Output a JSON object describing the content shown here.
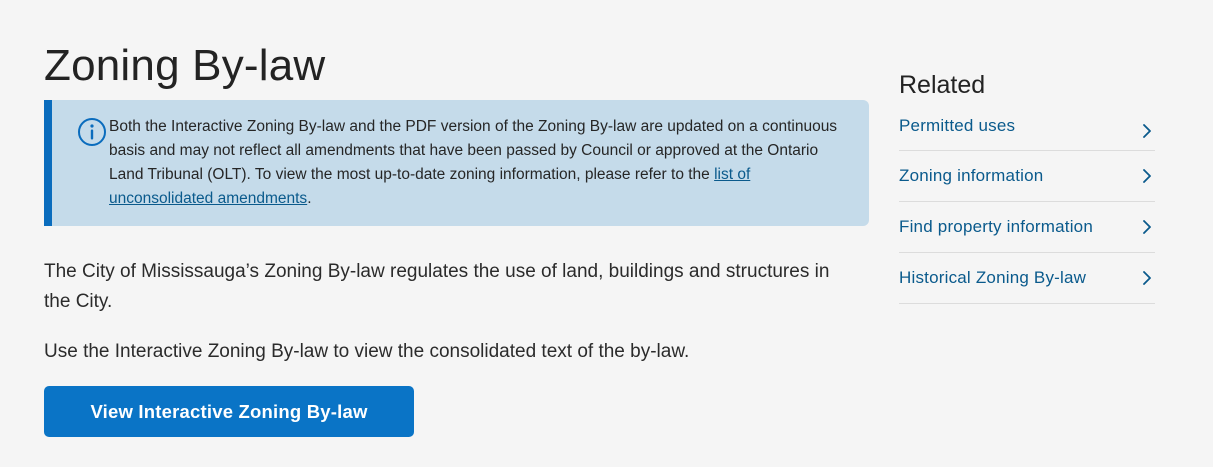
{
  "main": {
    "title": "Zoning By-law",
    "notice": {
      "text_before": "Both the Interactive Zoning By-law and the PDF version of the Zoning By-law are updated on a continuous basis and may not reflect all amendments that have been passed by Council or approved at the Ontario Land Tribunal (OLT). To view the most up-to-date zoning information, please refer to the ",
      "link_text": "list of unconsolidated amendments",
      "text_after": ".",
      "icon": "info-icon"
    },
    "intro_paragraph": "The City of Mississauga’s Zoning By-law regulates the use of land, buildings and structures in the City.",
    "interactive_paragraph": "Use the Interactive Zoning By-law to view the consolidated text of the by-law.",
    "cta_label": "View Interactive Zoning By-law"
  },
  "related": {
    "title": "Related",
    "items": [
      {
        "label": "Permitted uses",
        "icon": "chevron-right-icon"
      },
      {
        "label": "Zoning information",
        "icon": "chevron-right-icon"
      },
      {
        "label": "Find property information",
        "icon": "chevron-right-icon"
      },
      {
        "label": "Historical Zoning By-law",
        "icon": "chevron-right-icon"
      }
    ]
  },
  "colors": {
    "background": "#f5f5f5",
    "notice_background": "#c5dbea",
    "notice_border": "#0a6cbd",
    "button": "#0a74c6",
    "link": "#0a5a8c"
  }
}
